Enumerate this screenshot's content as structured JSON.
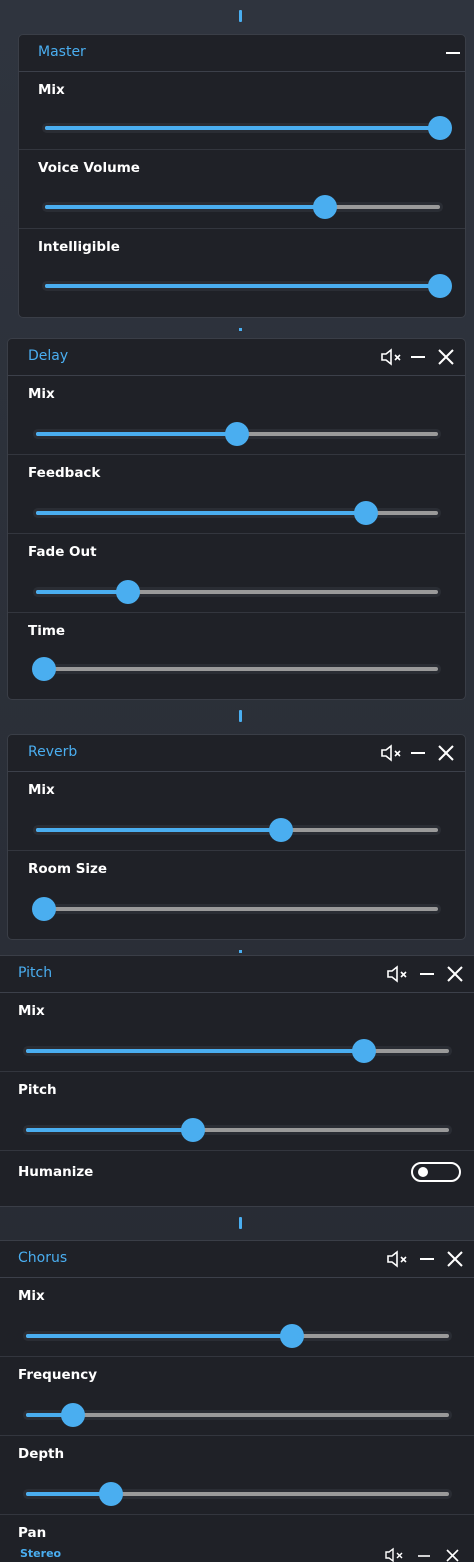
{
  "colors": {
    "accent": "#4aaef0",
    "panel_bg": "#1f2127",
    "track": "#9a9a9a",
    "label": "#ffffff"
  },
  "master": {
    "title": "Master",
    "collapse_icon": "minus-icon",
    "sliders": [
      {
        "label": "Mix",
        "value": 1.0
      },
      {
        "label": "Voice Volume",
        "value": 0.71
      },
      {
        "label": "Intelligible",
        "value": 1.0
      }
    ]
  },
  "delay": {
    "title": "Delay",
    "icons": [
      "mute-icon",
      "minus-icon",
      "close-icon"
    ],
    "sliders": [
      {
        "label": "Mix",
        "value": 0.5
      },
      {
        "label": "Feedback",
        "value": 0.82
      },
      {
        "label": "Fade Out",
        "value": 0.23
      },
      {
        "label": "Time",
        "value": 0.0
      }
    ]
  },
  "reverb": {
    "title": "Reverb",
    "icons": [
      "mute-icon",
      "minus-icon",
      "close-icon"
    ],
    "sliders": [
      {
        "label": "Mix",
        "value": 0.61
      },
      {
        "label": "Room Size",
        "value": 0.0
      }
    ]
  },
  "pitch": {
    "title": "Pitch",
    "icons": [
      "mute-icon",
      "minus-icon",
      "close-icon"
    ],
    "sliders": [
      {
        "label": "Mix",
        "value": 0.8
      },
      {
        "label": "Pitch",
        "value": 0.39
      }
    ],
    "toggle": {
      "label": "Humanize",
      "on": false
    }
  },
  "chorus": {
    "title": "Chorus",
    "icons": [
      "mute-icon",
      "minus-icon",
      "close-icon"
    ],
    "sliders": [
      {
        "label": "Mix",
        "value": 0.63
      },
      {
        "label": "Frequency",
        "value": 0.11
      },
      {
        "label": "Depth",
        "value": 0.2
      }
    ],
    "extra_label": "Pan"
  },
  "stereo": {
    "title": "Stereo",
    "icons": [
      "mute-icon",
      "minus-icon",
      "close-icon"
    ]
  }
}
